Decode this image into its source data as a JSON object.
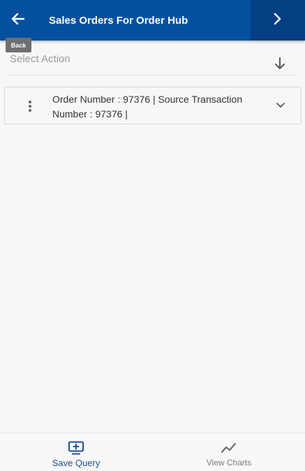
{
  "header": {
    "title": "Sales Orders For Order Hub",
    "back_icon": "arrow-left-icon",
    "forward_icon": "chevron-right-icon",
    "background": "#04509f"
  },
  "tooltip": {
    "text": "Back"
  },
  "action": {
    "label": "Select Action",
    "sort_icon": "arrow-down-icon"
  },
  "records": [
    {
      "text": "Order Number : 97376 | Source Transaction Number : 97376 |",
      "menu_icon": "vertical-ellipsis-icon",
      "expand_icon": "chevron-down-icon"
    }
  ],
  "bottom_bar": {
    "save_query": {
      "label": "Save Query",
      "icon": "monitor-plus-icon",
      "color": "#1f4e8f"
    },
    "view_charts": {
      "label": "View Charts",
      "icon": "line-chart-icon",
      "color": "#7a7a7a"
    }
  }
}
